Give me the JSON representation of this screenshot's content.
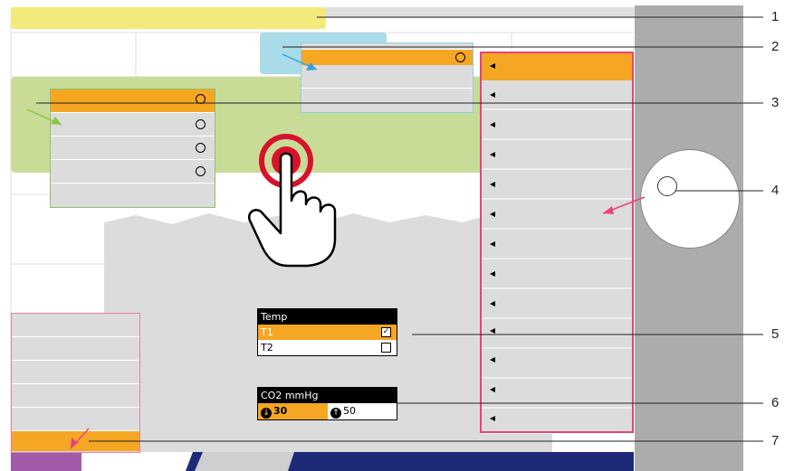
{
  "callouts": [
    "1",
    "2",
    "3",
    "4",
    "5",
    "6",
    "7"
  ],
  "temp_widget": {
    "title": "Temp",
    "rows": [
      {
        "label": "T1",
        "checked": true
      },
      {
        "label": "T2",
        "checked": false
      }
    ]
  },
  "co2_widget": {
    "title": "CO2 mmHg",
    "low_value": "30",
    "high_value": "50"
  },
  "colors": {
    "orange": "#f5a623",
    "green": "#c8dc98",
    "light_blue": "#aadbe8",
    "pink": "#e8427e",
    "yellow": "#f2ea7a",
    "gray": "#dcdcdc",
    "dark_gray": "#ababab",
    "navy": "#1e2a78",
    "purple": "#a05aa8",
    "red": "#d9122c"
  }
}
